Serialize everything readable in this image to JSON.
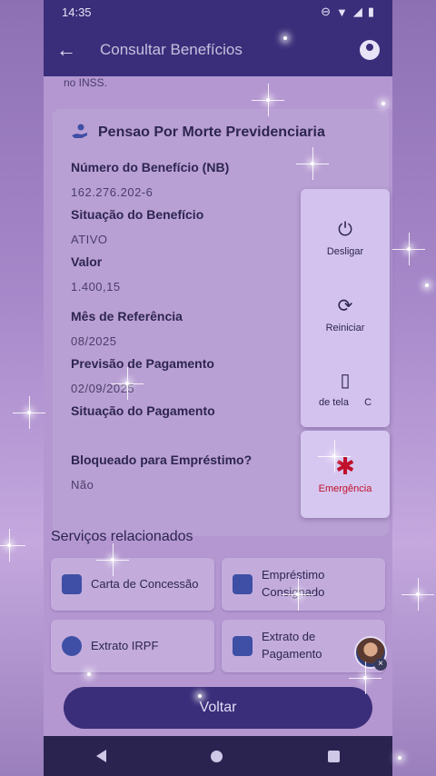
{
  "status_bar": {
    "time": "14:35",
    "icons": [
      "do-not-disturb-icon",
      "wifi-icon",
      "signal-icon",
      "battery-icon"
    ]
  },
  "app_bar": {
    "back_icon": "arrow-back-icon",
    "title": "Consultar Benefícios",
    "profile_icon": "account-circle-icon"
  },
  "content": {
    "top_note": "no INSS.",
    "benefit": {
      "icon": "hand-money-icon",
      "title": "Pensao Por Morte Previdenciaria",
      "fields": [
        {
          "label": "Número do Benefício (NB)",
          "value": "162.276.202-6"
        },
        {
          "label": "Situação do Benefício",
          "value": "ATIVO"
        },
        {
          "label": "Valor",
          "value": "1.400,15"
        },
        {
          "label": "Mês de Referência",
          "value": "08/2025"
        },
        {
          "label": "Previsão de Pagamento",
          "value": "02/09/2025"
        },
        {
          "label": "Situação do Pagamento",
          "value": ""
        },
        {
          "label": "Bloqueado para Empréstimo?",
          "value": "Não"
        }
      ]
    },
    "services": {
      "title": "Serviços relacionados",
      "items": [
        {
          "label": "Carta de Concessão",
          "icon": "document-icon"
        },
        {
          "label": "Empréstimo\nConsignado",
          "icon": "document-money-icon"
        },
        {
          "label": "Extrato IRPF",
          "icon": "lion-icon"
        },
        {
          "label": "Extrato de\nPagamento",
          "icon": "document-money-icon"
        }
      ]
    },
    "back_button": "Voltar"
  },
  "power_menu": {
    "power_off": {
      "label": "Desligar",
      "icon": "power-icon"
    },
    "restart": {
      "label": "Reiniciar",
      "icon": "restart-icon"
    },
    "screenshot": {
      "label": "de tela",
      "label_suffix": "C",
      "icon": "phone-icon"
    },
    "emergency": {
      "label": "Emergência",
      "icon": "asterisk-icon",
      "color": "#c0102a"
    }
  },
  "nav_bar": {
    "icons": [
      "nav-back-icon",
      "nav-home-icon",
      "nav-recents-icon"
    ]
  }
}
